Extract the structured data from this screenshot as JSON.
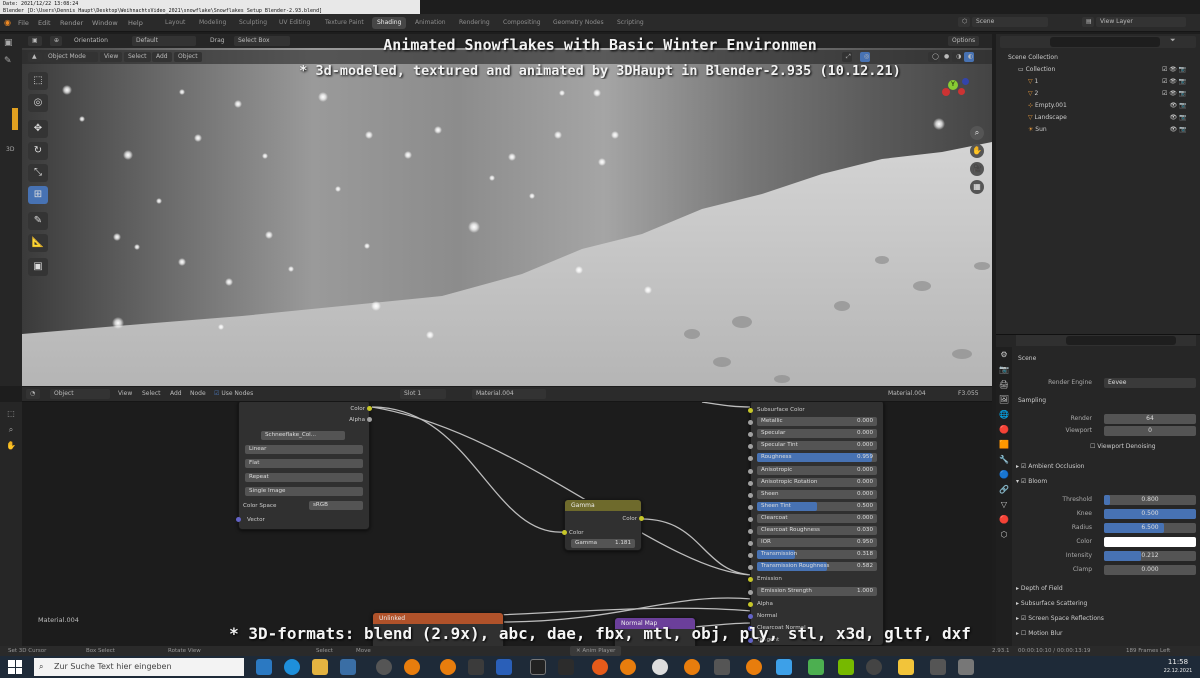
{
  "meta": {
    "line1": "Date: 2021/12/22 13:08:24",
    "line2": "Blender [D:\\Users\\Dennis Haupt\\Desktop\\WeihnachtsVideo_2021\\snowflake\\Snowflakes Setup Blender-2.93.blend]",
    "line3": "Modeled and textured by 3DHaupt in Blender-2.8"
  },
  "menus": [
    "File",
    "Edit",
    "Render",
    "Window",
    "Help"
  ],
  "workspaces": [
    "Layout",
    "Modeling",
    "Sculpting",
    "UV Editing",
    "Texture Paint",
    "Shading",
    "Animation",
    "Rendering",
    "Compositing",
    "Geometry Nodes",
    "Scripting"
  ],
  "active_workspace": "Shading",
  "scene_name": "Scene",
  "view_layer": "View Layer",
  "viewport": {
    "orientation_label": "Orientation",
    "orientation_value": "Default",
    "drag_label": "Drag",
    "drag_value": "Select Box",
    "options": "Options",
    "mode": "Object Mode",
    "menu": [
      "View",
      "Select",
      "Add",
      "Object"
    ],
    "side_label": "3D"
  },
  "overlay": {
    "title": "Animated Snowflakes with Basic Winter Environmen",
    "subtitle": "* 3d-modeled, textured and animated by 3DHaupt in Blender-2.935 (10.12.21)",
    "bottom": "* 3D-formats: blend (2.9x), abc, dae, fbx, mtl, obj, ply, stl, x3d, gltf, dxf"
  },
  "outliner": {
    "rows": [
      "Scene Collection",
      "Collection",
      "1",
      "2",
      "Empty.001",
      "Landscape",
      "Sun"
    ]
  },
  "node_editor": {
    "mode": "Object",
    "menu": [
      "View",
      "Select",
      "Add",
      "Node"
    ],
    "use_nodes": "Use Nodes",
    "slot": "Slot 1",
    "material": "Material.004",
    "material_right": "Material.004",
    "frame": "F3.055",
    "footer_label": "Material.004",
    "image_node": {
      "out_color": "Color",
      "out_alpha": "Alpha",
      "image": "Schneeflake_Col...",
      "interp": "Linear",
      "proj": "Flat",
      "ext": "Repeat",
      "source": "Single Image",
      "color_space_label": "Color Space",
      "color_space": "sRGB",
      "vector": "Vector"
    },
    "gamma_node": {
      "title": "Gamma",
      "out": "Color",
      "in": "Color",
      "gamma_label": "Gamma",
      "gamma": "1.181"
    },
    "bsdf_rows": [
      {
        "label": "Subsurface Color",
        "value": ""
      },
      {
        "label": "Metallic",
        "value": "0.000"
      },
      {
        "label": "Specular",
        "value": "0.000"
      },
      {
        "label": "Specular Tint",
        "value": "0.000"
      },
      {
        "label": "Roughness",
        "value": "0.959"
      },
      {
        "label": "Anisotropic",
        "value": "0.000"
      },
      {
        "label": "Anisotropic Rotation",
        "value": "0.000"
      },
      {
        "label": "Sheen",
        "value": "0.000"
      },
      {
        "label": "Sheen Tint",
        "value": "0.500"
      },
      {
        "label": "Clearcoat",
        "value": "0.000"
      },
      {
        "label": "Clearcoat Roughness",
        "value": "0.030"
      },
      {
        "label": "IOR",
        "value": "0.950"
      },
      {
        "label": "Transmission",
        "value": "0.318"
      },
      {
        "label": "Transmission Roughness",
        "value": "0.582"
      },
      {
        "label": "Emission",
        "value": ""
      },
      {
        "label": "Emission Strength",
        "value": "1.000"
      },
      {
        "label": "Alpha",
        "value": ""
      },
      {
        "label": "Normal",
        "value": ""
      },
      {
        "label": "Clearcoat Normal",
        "value": ""
      },
      {
        "label": "Tangent",
        "value": ""
      }
    ],
    "bsdf_fill": [
      0,
      0,
      0,
      0,
      0.959,
      0,
      0,
      0,
      0.5,
      0,
      0,
      0,
      0.318,
      0.582,
      0,
      0,
      0,
      0,
      0,
      0
    ],
    "unlinked_node": "Unlinked",
    "normal_map_node": "Normal Map"
  },
  "properties": {
    "scene": "Scene",
    "render_engine_label": "Render Engine",
    "render_engine": "Eevee",
    "sampling": "Sampling",
    "render_label": "Render",
    "render": "64",
    "viewport_label": "Viewport",
    "viewport_val": "0",
    "denoise": "Viewport Denoising",
    "ao": "Ambient Occlusion",
    "bloom": "Bloom",
    "threshold_label": "Threshold",
    "threshold": "0.800",
    "knee_label": "Knee",
    "knee": "0.500",
    "radius_label": "Radius",
    "radius": "6.500",
    "color_label": "Color",
    "intensity_label": "Intensity",
    "intensity": "0.212",
    "clamp_label": "Clamp",
    "clamp": "0.000",
    "dof": "Depth of Field",
    "sss": "Subsurface Scattering",
    "ssr": "Screen Space Reflections",
    "motion_blur": "Motion Blur"
  },
  "status": {
    "left1": "Set 3D Cursor",
    "left2": "Box Select",
    "left3": "Rotate View",
    "mid1": "Select",
    "mid2": "Move",
    "anim": "Anim Player",
    "version": "2.93.1",
    "timecode": "00:00:10:10 / 00:00:13:19",
    "frames": "189 Frames Left"
  },
  "taskbar": {
    "search_placeholder": "Zur Suche Text hier eingeben",
    "time": "11:58",
    "date": "22.12.2021"
  },
  "colors": {
    "accent": "#4772b3",
    "node_gamma": "#6e6a2c",
    "node_unlinked": "#b0522a",
    "node_normal": "#6b3f9a",
    "socket_yellow": "#c7c729",
    "socket_blue": "#6363c7",
    "socket_gray": "#a1a1a1"
  }
}
